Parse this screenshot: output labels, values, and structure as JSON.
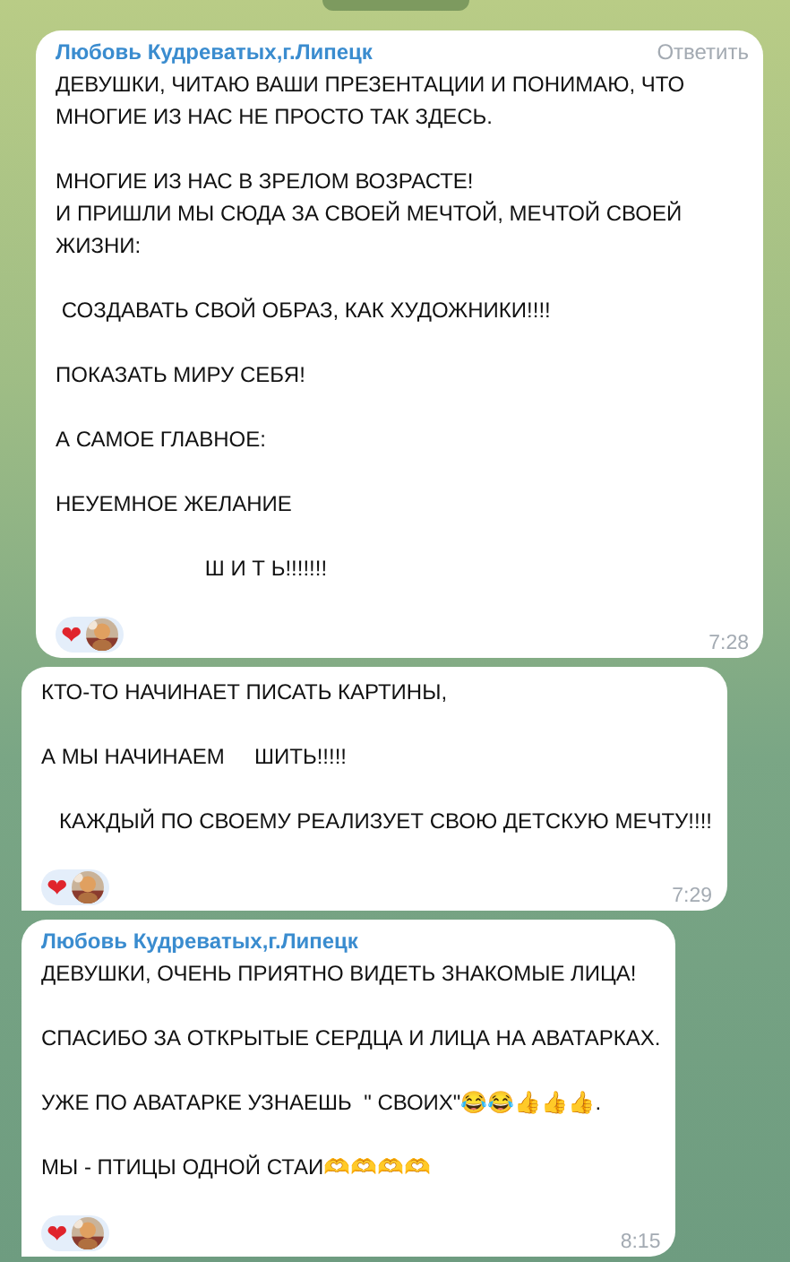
{
  "messages": [
    {
      "sender": "Любовь Кудреватых,г.Липецк",
      "reply_action": "Ответить",
      "tail": false,
      "indent": true,
      "paragraphs": [
        "ДЕВУШКИ, ЧИТАЮ ВАШИ ПРЕЗЕНТАЦИИ И ПОНИМАЮ, ЧТО МНОГИЕ ИЗ НАС НЕ ПРОСТО ТАК ЗДЕСЬ.",
        "МНОГИЕ ИЗ НАС В ЗРЕЛОМ ВОЗРАСТЕ!\nИ ПРИШЛИ МЫ СЮДА ЗА СВОЕЙ МЕЧТОЙ, МЕЧТОЙ СВОЕЙ ЖИЗНИ:",
        " СОЗДАВАТЬ СВОЙ ОБРАЗ, КАК ХУДОЖНИКИ!!!!",
        "ПОКАЗАТЬ МИРУ СЕБЯ!",
        "А САМОЕ ГЛАВНОЕ:",
        "НЕУЕМНОЕ ЖЕЛАНИЕ",
        "                         Ш И Т Ь!!!!!!!"
      ],
      "reaction": "❤",
      "time": "7:28"
    },
    {
      "tail": true,
      "indent": false,
      "paragraphs": [
        "КТО-ТО НАЧИНАЕТ ПИСАТЬ КАРТИНЫ,",
        "А МЫ НАЧИНАЕМ     ШИТЬ!!!!!",
        "   КАЖДЫЙ ПО СВОЕМУ РЕАЛИЗУЕТ СВОЮ ДЕТСКУЮ МЕЧТУ!!!!"
      ],
      "reaction": "❤",
      "time": "7:29"
    },
    {
      "sender": "Любовь Кудреватых,г.Липецк",
      "tail": true,
      "indent": false,
      "paragraphs": [
        "ДЕВУШКИ, ОЧЕНЬ ПРИЯТНО ВИДЕТЬ ЗНАКОМЫЕ ЛИЦА!",
        "СПАСИБО ЗА ОТКРЫТЫЕ СЕРДЦА И ЛИЦА НА АВАТАРКАХ.",
        "УЖЕ ПО АВАТАРКЕ УЗНАЕШЬ  \" СВОИХ\"😂😂👍👍👍.",
        "МЫ - ПТИЦЫ ОДНОЙ СТАИ🫶🫶🫶🫶"
      ],
      "reaction": "❤",
      "time": "8:15"
    }
  ]
}
